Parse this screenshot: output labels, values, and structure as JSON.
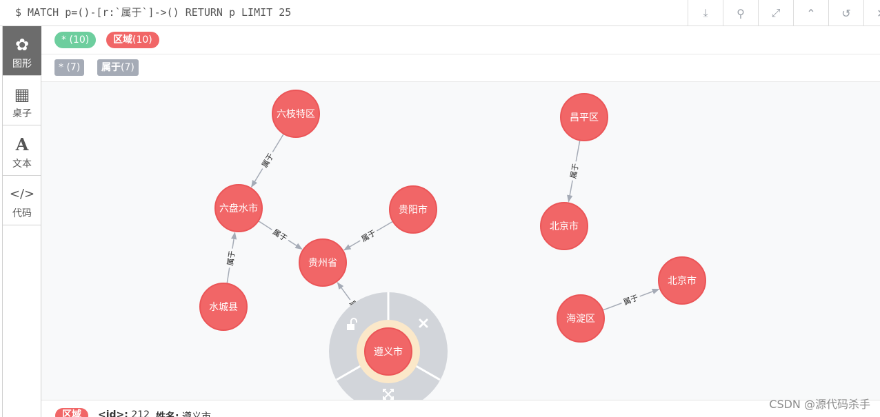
{
  "query": "$ MATCH p=()-[r:`属于`]->() RETURN p LIMIT 25",
  "toolbar": [
    {
      "name": "download-icon",
      "glyph": "⤓"
    },
    {
      "name": "pin-icon",
      "glyph": "⚲"
    },
    {
      "name": "expand-icon",
      "glyph": "⤢"
    },
    {
      "name": "collapse-up-icon",
      "glyph": "⌃"
    },
    {
      "name": "refresh-icon",
      "glyph": "↺"
    },
    {
      "name": "close-icon",
      "glyph": "✕"
    }
  ],
  "sidebar": {
    "items": [
      {
        "label": "图形",
        "icon": "graph-icon",
        "glyph": "✿",
        "active": true
      },
      {
        "label": "桌子",
        "icon": "table-icon",
        "glyph": "▦",
        "active": false
      },
      {
        "label": "文本",
        "icon": "text-icon",
        "glyph": "A",
        "active": false
      },
      {
        "label": "代码",
        "icon": "code-icon",
        "glyph": "</>",
        "active": false
      }
    ]
  },
  "node_labels": {
    "all": "* (10)",
    "region": "区域",
    "region_count": "(10)",
    "all_color": "#6dce9e",
    "region_color": "#f16667"
  },
  "rel_types": {
    "all": "* (7)",
    "belongs_type": "属于",
    "belongs_count": "(7)"
  },
  "graph": {
    "node_fill": "#f16667",
    "node_stroke": "#eb5557",
    "edge_color": "#a5abb6",
    "nodes": {
      "n1": "六枝特区",
      "n2": "六盘水市",
      "n3": "贵阳市",
      "n4": "贵州省",
      "n5": "水城县",
      "n6": "遵义市",
      "n7": "昌平区",
      "n8": "北京市",
      "n9": "北京市",
      "n10": "海淀区"
    },
    "edge_label": "属于"
  },
  "footer": {
    "badge": "区域",
    "id_key": "<id>:",
    "id_value": " 212",
    "name_key": "姓名:",
    "name_value": " 遵义市"
  },
  "watermark": "CSDN @源代码杀手"
}
